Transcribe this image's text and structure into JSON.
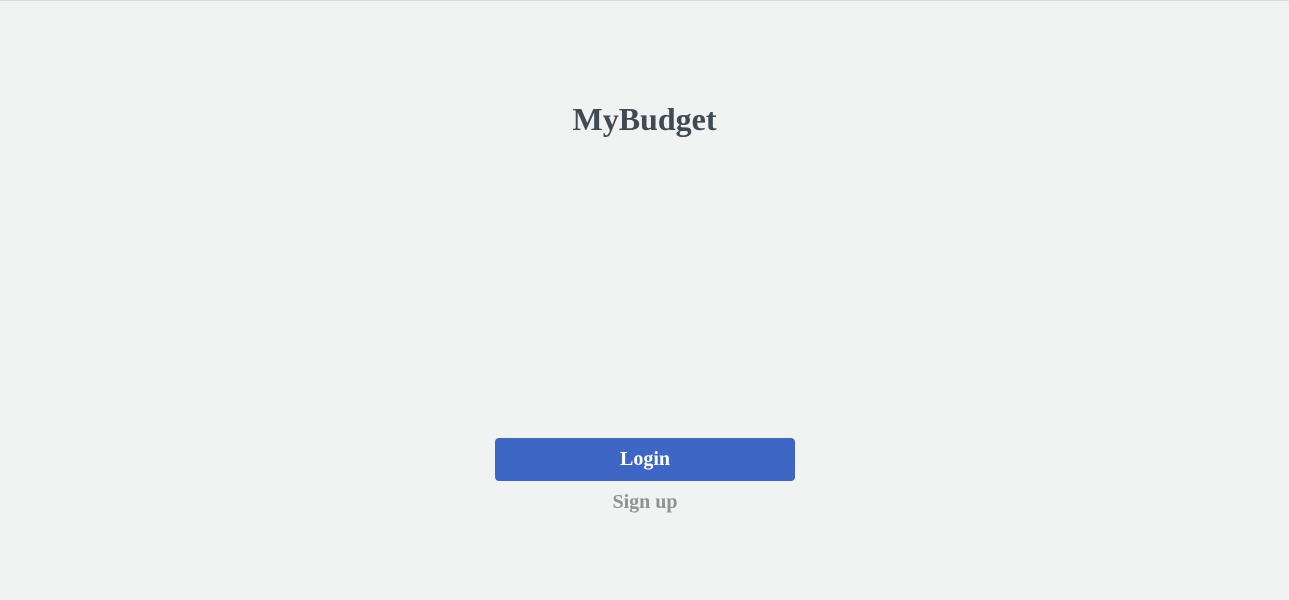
{
  "app": {
    "title": "MyBudget"
  },
  "auth": {
    "login_label": "Login",
    "signup_label": "Sign up"
  },
  "colors": {
    "background": "#f1f2f2",
    "title": "#3f4a53",
    "primary_button": "#3d66c5",
    "primary_button_text": "#ffffff",
    "secondary_link": "#8f9293"
  }
}
